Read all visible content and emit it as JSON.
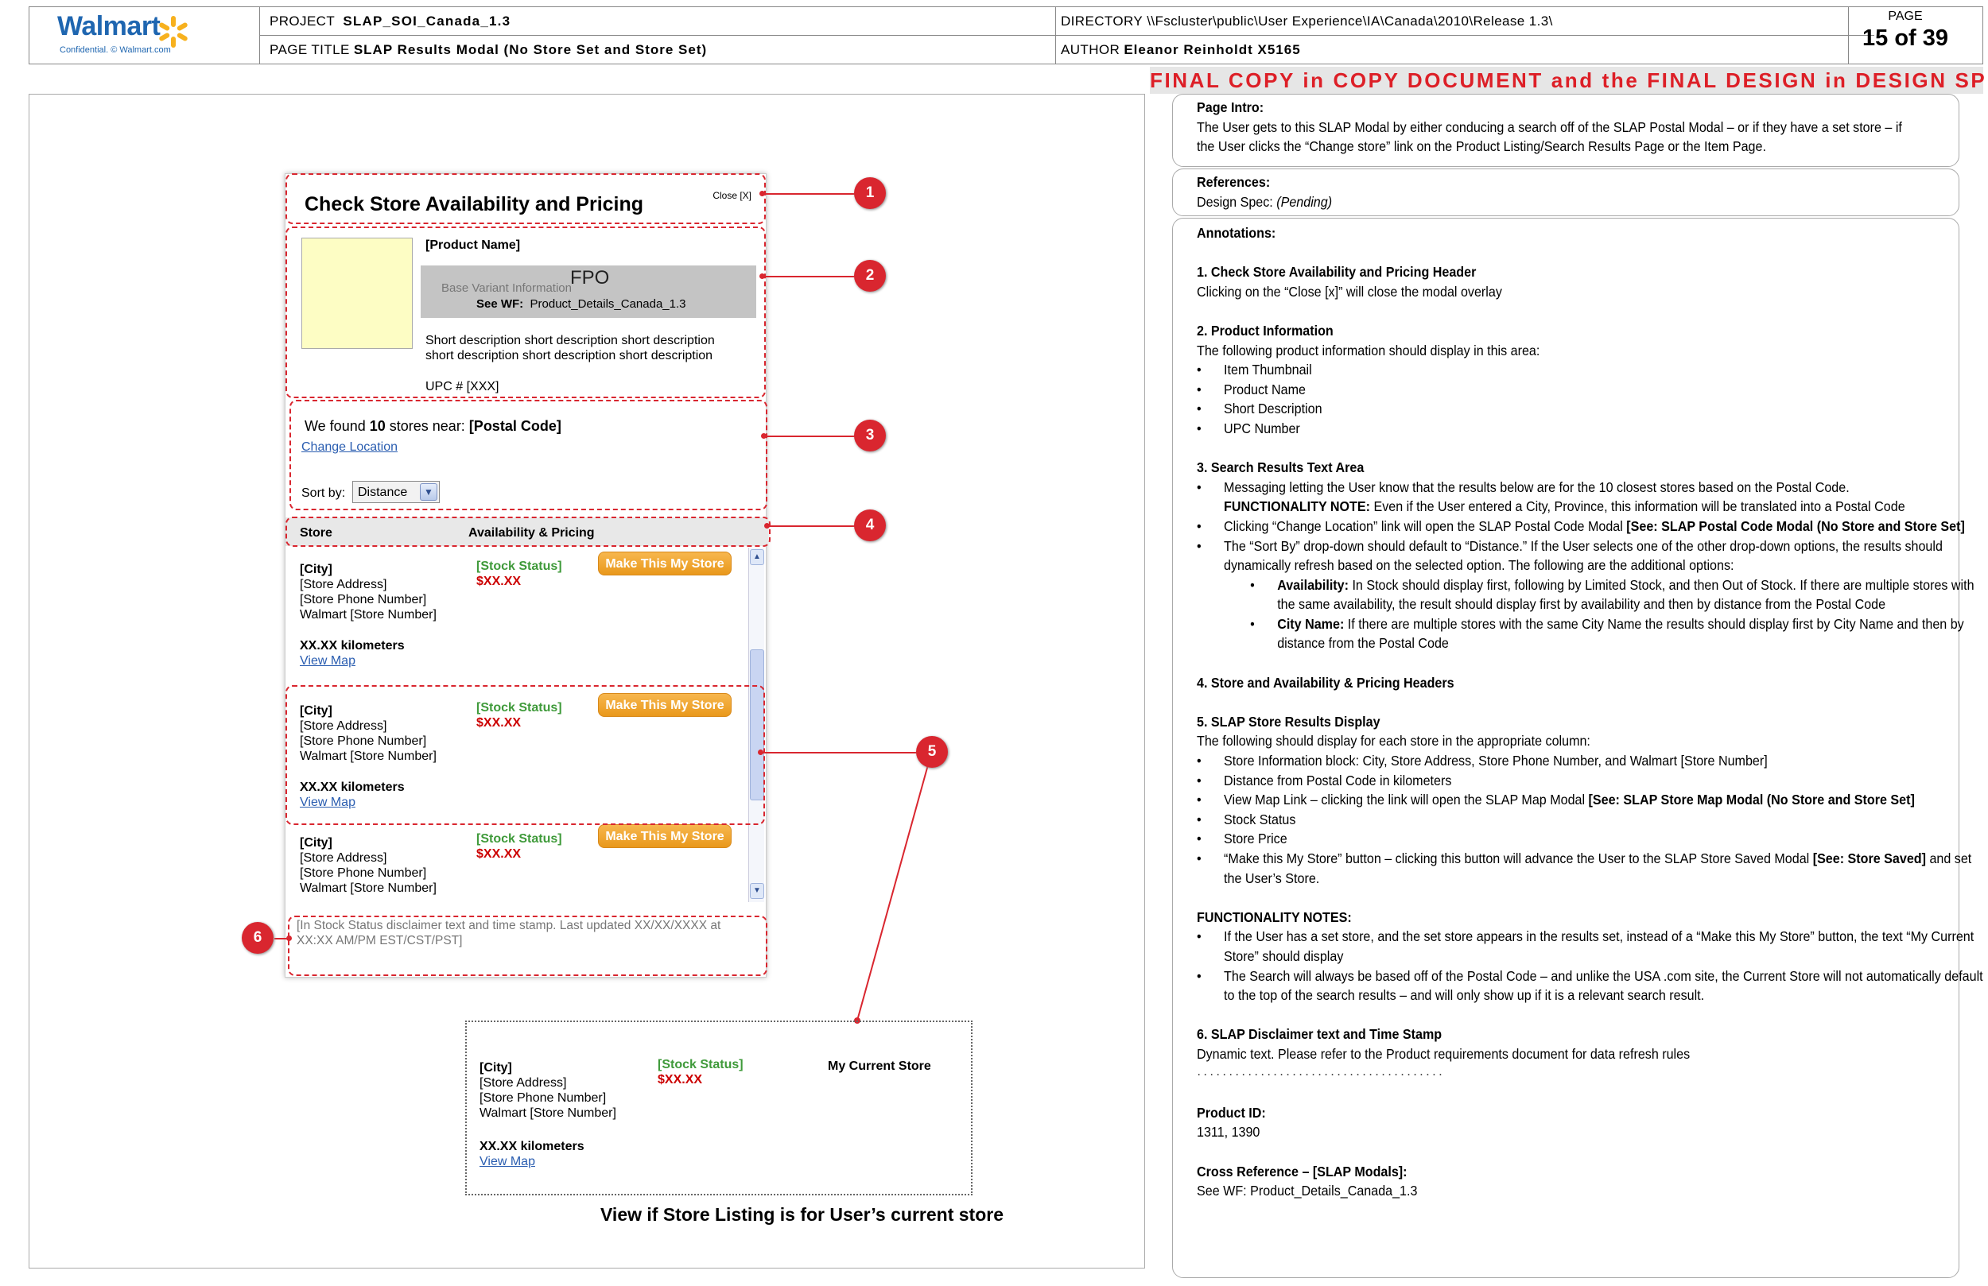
{
  "header": {
    "logo_text": "Walmart",
    "logo_sub": "Confidential. © Walmart.com",
    "project_label": "PROJECT",
    "project_value": "SLAP_SOI_Canada_1.3",
    "page_title_label": "PAGE TITLE",
    "page_title_value": "SLAP Results Modal (No Store Set and Store Set)",
    "directory_label": "DIRECTORY",
    "directory_value": "\\\\Fscluster\\public\\User Experience\\IA\\Canada\\2010\\Release 1.3\\",
    "author_label": "AUTHOR",
    "author_value": "Eleanor Reinholdt X5165",
    "page_label": "PAGE",
    "page_value": "15 of 39"
  },
  "banner": "FINAL COPY in COPY DOCUMENT and the FINAL DESIGN in DESIGN SPECS",
  "modal": {
    "title": "Check Store Availability and Pricing",
    "close": "Close [X]",
    "product_name": "[Product Name]",
    "fpo": "FPO",
    "base_variant": "Base Variant Information",
    "see_wf_label": "See WF:",
    "see_wf_value": "Product_Details_Canada_1.3",
    "short_desc_1": "Short description short description short description",
    "short_desc_2": "short description short description short description",
    "upc": "UPC # [XXX]",
    "found_pre": "We found ",
    "found_count": "10",
    "found_mid": " stores near: ",
    "found_postal": "[Postal Code]",
    "change_location": "Change Location",
    "sort_label": "Sort by:",
    "sort_value": "Distance",
    "col_store": "Store",
    "col_avail": "Availability & Pricing",
    "stores": [
      {
        "city": "[City]",
        "address": "[Store Address]",
        "phone": "[Store Phone Number]",
        "number": "Walmart [Store Number]",
        "distance": "XX.XX kilometers",
        "map": "View Map",
        "status": "[Stock Status]",
        "price": "$XX.XX",
        "button": "Make This My Store"
      },
      {
        "city": "[City]",
        "address": "[Store Address]",
        "phone": "[Store Phone Number]",
        "number": "Walmart [Store Number]",
        "distance": "XX.XX kilometers",
        "map": "View Map",
        "status": "[Stock Status]",
        "price": "$XX.XX",
        "button": "Make This My Store"
      },
      {
        "city": "[City]",
        "address": "[Store Address]",
        "phone": "[Store Phone Number]",
        "number": "Walmart [Store Number]",
        "status": "[Stock Status]",
        "price": "$XX.XX",
        "button": "Make This My Store"
      }
    ],
    "disclaimer_1": "[In Stock Status disclaimer text and time stamp. Last updated XX/XX/XXXX at",
    "disclaimer_2": "XX:XX AM/PM EST/CST/PST]"
  },
  "current_store": {
    "city": "[City]",
    "address": "[Store Address]",
    "phone": "[Store Phone Number]",
    "number": "Walmart [Store Number]",
    "distance": "XX.XX kilometers",
    "map": "View Map",
    "status": "[Stock Status]",
    "price": "$XX.XX",
    "label": "My Current Store",
    "caption": "View if Store Listing is for User’s current store"
  },
  "callouts": [
    "1",
    "2",
    "3",
    "4",
    "5",
    "6"
  ],
  "right": {
    "intro_title": "Page Intro:",
    "intro_1": "The User gets to this SLAP Modal by either conducing a search off of the SLAP Postal Modal – or if they have a set store – if",
    "intro_2": "the User clicks the “Change store” link on the Product Listing/Search Results Page or the Item Page.",
    "ref_title": "References:",
    "ref_label": "Design Spec:",
    "ref_value": "(Pending)",
    "ann_title": "Annotations:",
    "a1_title": "1. Check Store Availability and Pricing Header",
    "a1_text": "Clicking on the “Close [x]” will close the modal overlay",
    "a2_title": "2. Product Information",
    "a2_text": "The following product information should display in this area:",
    "a2_items": [
      "Item Thumbnail",
      "Product Name",
      "Short Description",
      "UPC Number"
    ],
    "a3_title": "3. Search Results Text Area",
    "a3_b1": "Messaging letting the User know that the results below are for the 10 closest stores based on the Postal Code.",
    "a3_b1_note_label": "FUNCTIONALITY NOTE:",
    "a3_b1_note": " Even if the User entered a City, Province, this information will be translated into a Postal Code",
    "a3_b2_pre": "Clicking “Change Location” link will open the SLAP Postal Code Modal ",
    "a3_b2_bold": "[See: SLAP Postal Code Modal (No Store and Store Set]",
    "a3_b3": "The “Sort By” drop-down should default to “Distance.” If the User selects one of the other drop-down options, the results should dynamically refresh based on the selected option. The following are the additional options:",
    "a3_s1_label": "Availability:",
    "a3_s1_text": "  In Stock should display first, following by Limited Stock, and then Out of Stock. If there are multiple stores with the same availability, the result should display first by availability and then by distance from the Postal Code",
    "a3_s2_label": "City Name:",
    "a3_s2_text": "  If there are multiple stores with the same City Name the results should display first by City Name and then by distance from the Postal Code",
    "a4_title": "4.  Store and Availability & Pricing Headers",
    "a5_title": "5. SLAP Store Results Display",
    "a5_text": "The following should display for each store in the appropriate column:",
    "a5_items": [
      "Store Information block:   City, Store Address, Store Phone Number, and Walmart [Store Number]",
      "Distance from Postal Code in kilometers"
    ],
    "a5_map_pre": "View Map Link – clicking the link will open the SLAP Map Modal  ",
    "a5_map_bold": "[See: SLAP Store Map Modal (No Store and Store Set]",
    "a5_items2": [
      "Stock Status",
      "Store Price"
    ],
    "a5_btn_pre": "“Make this My Store” button – clicking this button will advance the User to the SLAP Store Saved Modal  ",
    "a5_btn_bold": "[See: Store Saved]",
    "a5_btn_post": " and set the User’s Store.",
    "fn_title": "FUNCTIONALITY NOTES:",
    "fn_items": [
      "If the User has a set store, and the set store appears in the results set, instead of a “Make this My Store” button, the text “My Current Store” should display",
      "The Search will always be based off of the Postal Code – and unlike the USA .com site, the Current Store will not automatically default to the top of the search results – and will only show up if it is a relevant search result."
    ],
    "a6_title": "6. SLAP Disclaimer text and Time Stamp",
    "a6_text": "Dynamic text. Please refer to the Product requirements document for data refresh rules",
    "dots": "· · · · · · · · · · · · · · · · · · · · · · · · · · · · · · · · · · · · · · ·",
    "pid_title": "Product ID:",
    "pid_value": "1311, 1390",
    "xref_title": "Cross Reference – [SLAP Modals]:",
    "xref_value": "See WF:  Product_Details_Canada_1.3"
  },
  "colors": {
    "accent_red": "#d9262f",
    "walmart_blue": "#1f66b0",
    "button_orange": "#f0a534",
    "stock_green": "#3f9a3a",
    "price_red": "#cc0000"
  }
}
